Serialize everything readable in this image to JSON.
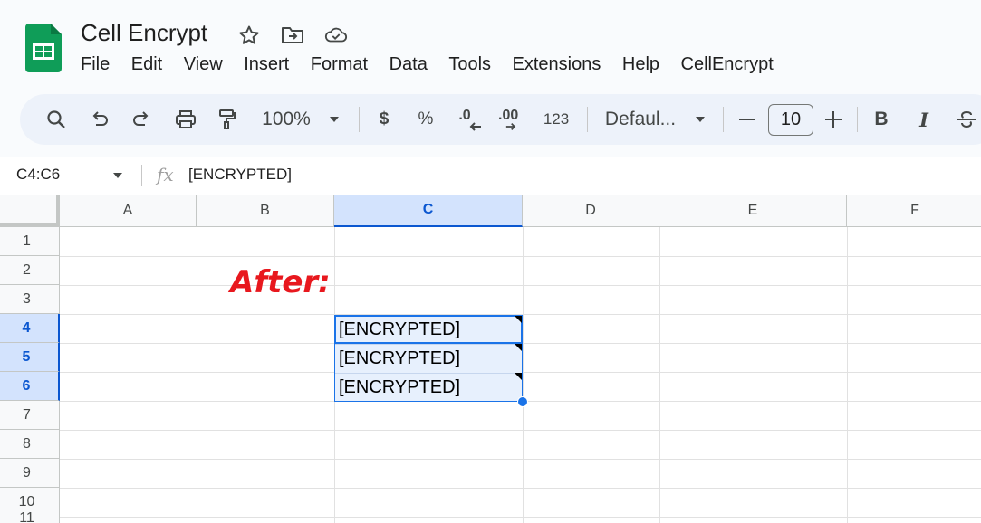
{
  "doc": {
    "title": "Cell Encrypt"
  },
  "header_icons": [
    "star-icon",
    "move-to-folder-icon",
    "cloud-saved-icon"
  ],
  "menu": [
    "File",
    "Edit",
    "View",
    "Insert",
    "Format",
    "Data",
    "Tools",
    "Extensions",
    "Help",
    "CellEncrypt"
  ],
  "toolbar": {
    "zoom": "100%",
    "currency": "$",
    "percent": "%",
    "dec_decrease": ".0",
    "dec_increase": ".00",
    "number_format": "123",
    "font": "Defaul...",
    "font_size": "10",
    "bold": "B",
    "italic": "I"
  },
  "formula_bar": {
    "name_box": "C4:C6",
    "fx": "fx",
    "content": "[ENCRYPTED]"
  },
  "columns": [
    "A",
    "B",
    "C",
    "D",
    "E",
    "F"
  ],
  "rows": [
    "1",
    "2",
    "3",
    "4",
    "5",
    "6",
    "7",
    "8",
    "9",
    "10",
    "11"
  ],
  "selected_column": "C",
  "selected_rows": [
    "4",
    "5",
    "6"
  ],
  "cells": [
    {
      "ref": "C4",
      "value": "[ENCRYPTED]"
    },
    {
      "ref": "C5",
      "value": "[ENCRYPTED]"
    },
    {
      "ref": "C6",
      "value": "[ENCRYPTED]"
    }
  ],
  "annotation": {
    "text": "After:",
    "color": "#e8181e"
  },
  "colors": {
    "accent": "#1a73e8",
    "selected_header": "#d3e3fd",
    "logo_green": "#0f9d58"
  }
}
